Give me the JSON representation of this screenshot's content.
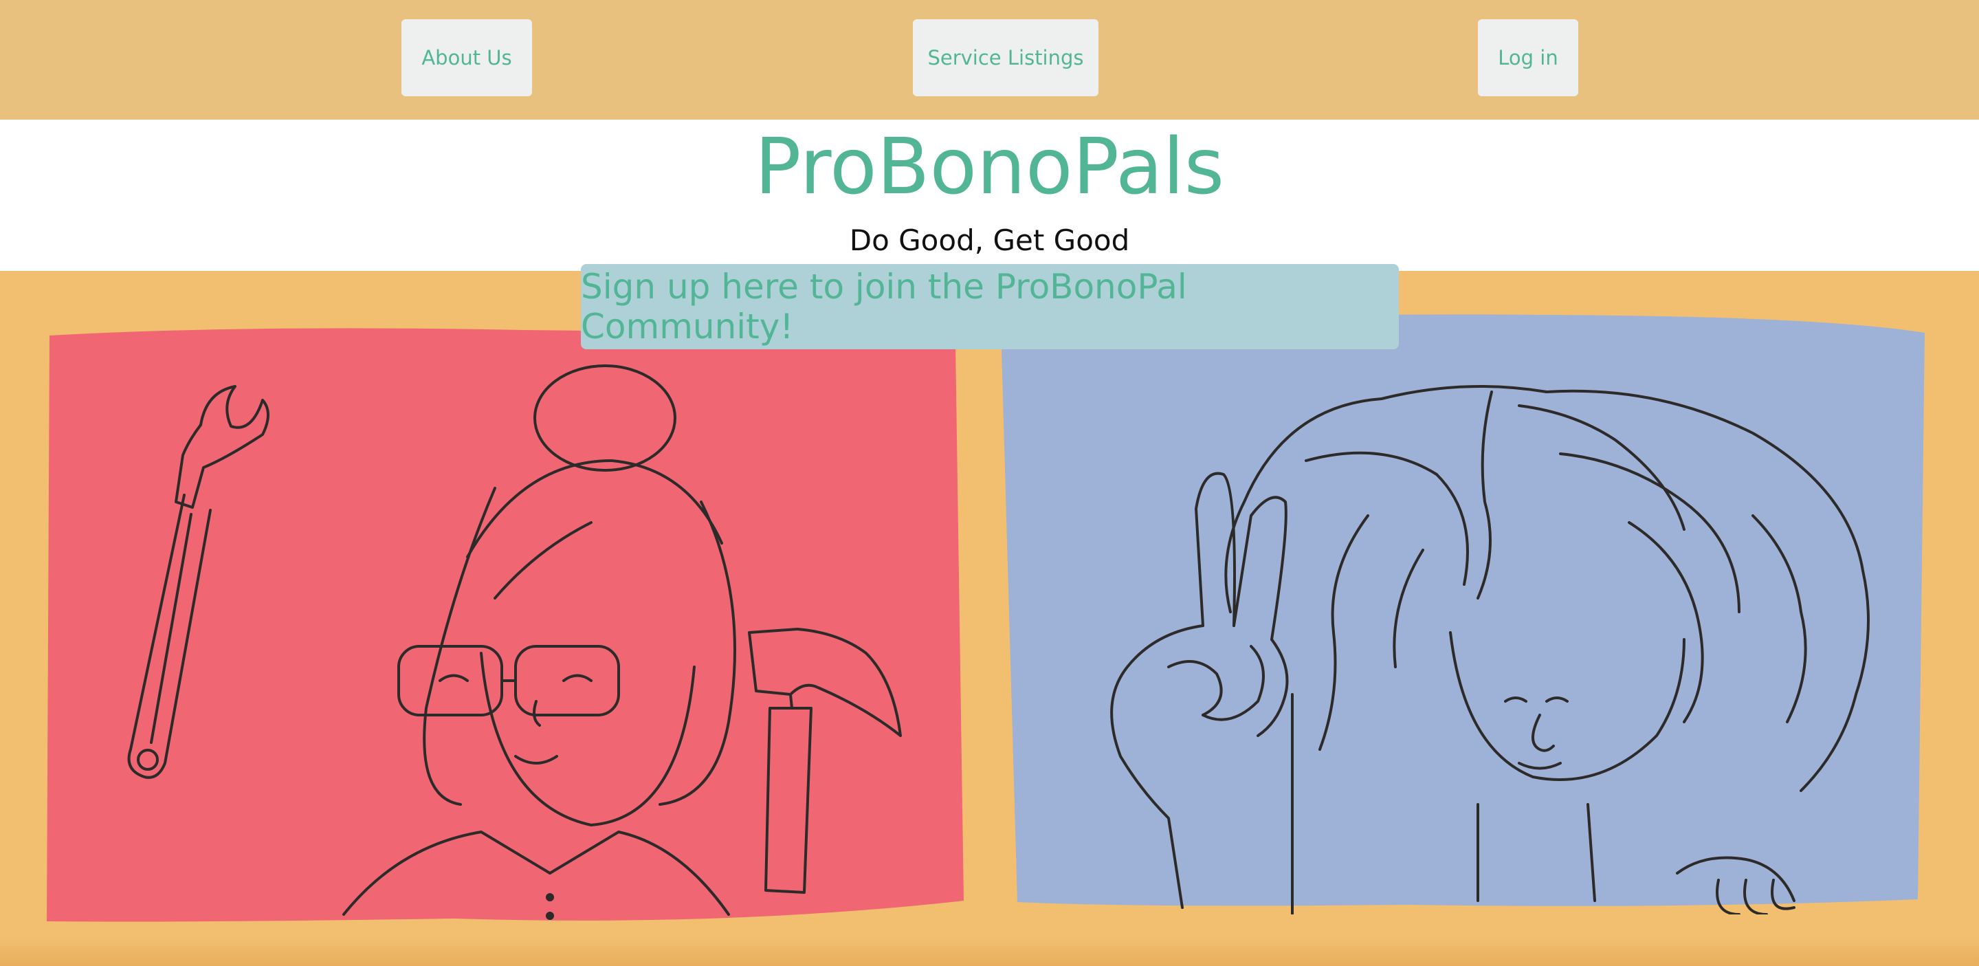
{
  "nav": {
    "about_label": "About Us",
    "services_label": "Service Listings",
    "login_label": "Log in"
  },
  "hero": {
    "title": "ProBonoPals",
    "tagline": "Do Good, Get Good"
  },
  "cta": {
    "signup_label": "Sign up here to join the ProBonoPal Community!"
  },
  "colors": {
    "accent": "#52b595",
    "nav_bg": "#e9c17e",
    "page_bg": "#f2bf71",
    "left_panel": "#f06773",
    "right_panel": "#9eb1d6",
    "signup_bg": "#aed1d8"
  },
  "illustrations": {
    "left_icons": [
      "wrench-icon",
      "hammer-icon",
      "woman-with-glasses-illustration"
    ],
    "right_icons": [
      "peace-sign-hand-icon",
      "curly-hair-woman-illustration"
    ]
  }
}
